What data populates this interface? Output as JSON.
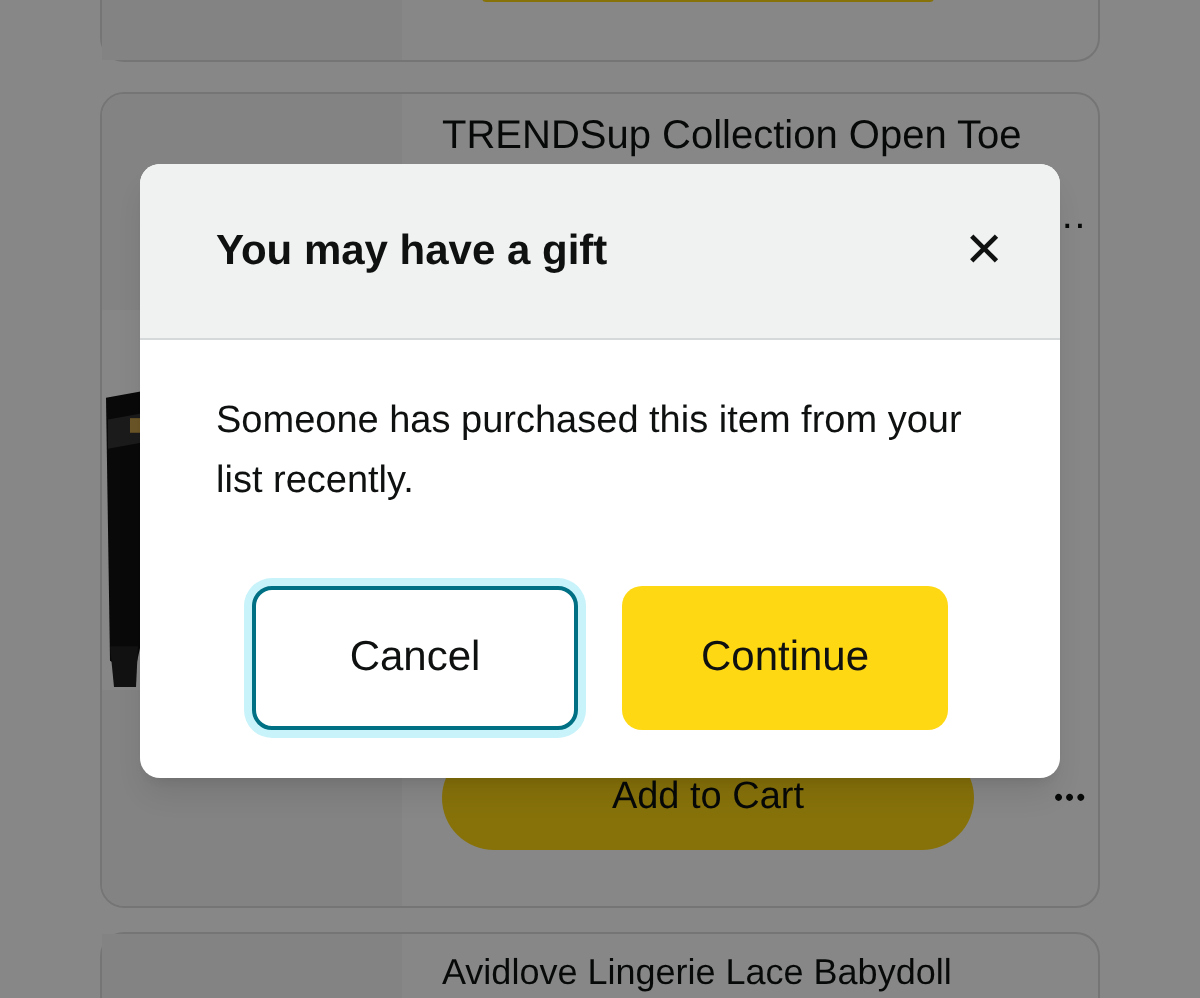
{
  "list_items": [
    {
      "title": "TRENDSup Collection Open Toe",
      "title_more": "…",
      "cart_button": "Add to Cart",
      "more": "•••"
    },
    {
      "title": "Avidlove Lingerie Lace Babydoll"
    }
  ],
  "dialog": {
    "title": "You may have a gift",
    "close": "✕",
    "message": "Someone has purchased this item from your list recently.",
    "buttons": [
      {
        "label": "Cancel",
        "kind": "secondary",
        "focused": true
      },
      {
        "label": "Continue",
        "kind": "primary",
        "focused": false
      }
    ]
  }
}
